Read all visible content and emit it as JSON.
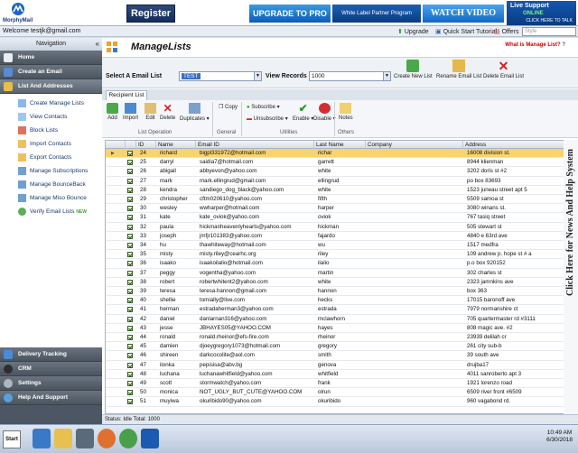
{
  "banner": {
    "logo_text": "MorphyMail",
    "register": "Register",
    "upgrade": "UPGRADE TO PRO",
    "white_label": "White Label Partner Program",
    "watch": "WATCH VIDEO",
    "live_support": "Live Support",
    "live_status": "ONLINE",
    "live_sub": "CLICK HERE TO TALK"
  },
  "topbar": {
    "welcome": "Welcome  testjk@gmail.com",
    "upgrade": "Upgrade",
    "quick_start": "Quick Start Tutorial",
    "offers": "Offers",
    "style": "Style"
  },
  "sidebar": {
    "navigation": "Navigation",
    "collapse": "«",
    "items_top": [
      {
        "label": "Home",
        "icon": "home-icon"
      },
      {
        "label": "Create an Email",
        "icon": "email-icon"
      },
      {
        "label": "List And Addresses",
        "icon": "list-icon"
      }
    ],
    "sub_items": [
      "Create  Manage Lists",
      "View Contacts",
      "Block Lists",
      "Import Contacts",
      "Export Contacts",
      "Manage Subscriptions",
      "Manage BounceBack",
      "Manage Miso Bounce",
      "Verify Email Lists"
    ],
    "new_badge": "NEW",
    "items_bottom": [
      {
        "label": "Delivery Tracking"
      },
      {
        "label": "CRM"
      },
      {
        "label": "Settings"
      },
      {
        "label": "Help And Support"
      }
    ]
  },
  "main": {
    "title": "ManageLists",
    "what_is": "What is Manage List?",
    "select_list_label": "Select A Email List",
    "select_list_value": "TEST",
    "view_records_label": "View Records",
    "view_records_value": "1000",
    "create_list": "Create New List",
    "rename_list": "Rename Email List",
    "delete_list": "Delete Email List",
    "tab": "Recipient List",
    "toolbar": {
      "add": "Add",
      "import": "Import",
      "edit": "Edit",
      "delete": "Delete",
      "duplicates": "Duplicates",
      "copy": "Copy",
      "subscribe": "Subscribe",
      "unsubscribe": "Unsubscribe",
      "enable": "Enable",
      "disable": "Disable",
      "notes": "Notes"
    },
    "groups": {
      "list_operation": "List Operation",
      "general": "General",
      "utilities": "Utilities",
      "others": "Others"
    },
    "columns": [
      "ID",
      "Name",
      "Email ID",
      "Last Name",
      "Company",
      "Address"
    ],
    "rows": [
      [
        "24",
        "richard",
        "bigpl331972@hotmail.com",
        "richar",
        "",
        "16008 division st."
      ],
      [
        "25",
        "darryl",
        "saidia7@hotmail.com",
        "garrett",
        "",
        "8944 klienman"
      ],
      [
        "26",
        "abigail",
        "abbyevon@yahoo.com",
        "white",
        "",
        "3202 doris st #2"
      ],
      [
        "27",
        "mark",
        "mark.ellingrud@gmail.com",
        "ellingrud",
        "",
        "po box 83693"
      ],
      [
        "28",
        "kendra",
        "sandiego_dog_black@yahoo.com",
        "white",
        "",
        "1523 juneau street apt 5"
      ],
      [
        "29",
        "christopher",
        "cftm020610@yahoo.com",
        "fifth",
        "",
        "5509 samoa st"
      ],
      [
        "30",
        "wesley",
        "wwharper@hotmail.com",
        "harper",
        "",
        "3080 winans st."
      ],
      [
        "31",
        "kate",
        "kate_oviok@yahoo.com",
        "oviok",
        "",
        "767 tasiq street"
      ],
      [
        "32",
        "paula",
        "hickmanheavenlyhearts@yahoo.com",
        "hickman",
        "",
        "505 stewart st"
      ],
      [
        "33",
        "joseph",
        "jmfjr101383@yahoo.com",
        "fajardo",
        "",
        "4840 e 63rd ave"
      ],
      [
        "34",
        "hu",
        "thawhiteway@hotmail.com",
        "wu",
        "",
        "1517 medfra"
      ],
      [
        "35",
        "misty",
        "misty.riley@cearhc.org",
        "riley",
        "",
        "109 andrew p. hope st # a"
      ],
      [
        "36",
        "isaako",
        "isaakoilalio@hotmail.com",
        "ilalio",
        "",
        "p.o box 920152"
      ],
      [
        "37",
        "peggy",
        "vogentha@yahoo.com",
        "martin",
        "",
        "302 charles st"
      ],
      [
        "38",
        "robert",
        "robertwhitent2@yahoo.com",
        "white",
        "",
        "2323 jamnkins ave"
      ],
      [
        "39",
        "teresa",
        "teresa.hannon@gmail.com",
        "hannon",
        "",
        "box 363"
      ],
      [
        "40",
        "shellie",
        "tomially@live.com",
        "hecks",
        "",
        "17015 baronoff ave"
      ],
      [
        "41",
        "herman",
        "estradaherman3@yahoo.com",
        "estrada",
        "",
        "7979 normanshire ct"
      ],
      [
        "42",
        "daniel",
        "danlarnan316@yahoo.com",
        "mclawhorn",
        "",
        "705 quartermaster rd #3111"
      ],
      [
        "43",
        "jesse",
        "JBHAYES05@YAHOO.COM",
        "hayes",
        "",
        "808 magic ave. #2"
      ],
      [
        "44",
        "ronald",
        "ronald.rheinor@efs-fire.com",
        "rheinor",
        "",
        "23939 delilah cr"
      ],
      [
        "45",
        "damien",
        "djoeygregory1073@hotmail.com",
        "gregory",
        "",
        "261 city sub-b"
      ],
      [
        "46",
        "shireen",
        "darkcocolite@aol.com",
        "smith",
        "",
        "39 south ave"
      ],
      [
        "47",
        "ilonka",
        "pepisisa@abv.bg",
        "genova",
        "",
        "drujba17"
      ],
      [
        "48",
        "luchana",
        "luchanawhitfield@yahoo.com",
        "whitfield",
        "",
        "4011 sanroberto apt 3"
      ],
      [
        "49",
        "scott",
        "stormwatch@yahoo.com",
        "frank",
        "",
        "1921 lorenzo road"
      ],
      [
        "50",
        "monica",
        "NOT_UGLY_BUT_CUTE@YAHOO.COM",
        "olrun",
        "",
        "6509 river front #6509"
      ],
      [
        "51",
        "muyiwa",
        "okuribido90@yahoo.com",
        "okuribido",
        "",
        "960 vagabond rd."
      ]
    ],
    "status": "Status: Idle    Total: 1000",
    "side_help": "Click Here for News And Help System"
  },
  "taskbar": {
    "start": "Start",
    "time": "10:49 AM",
    "date": "6/30/2018"
  }
}
